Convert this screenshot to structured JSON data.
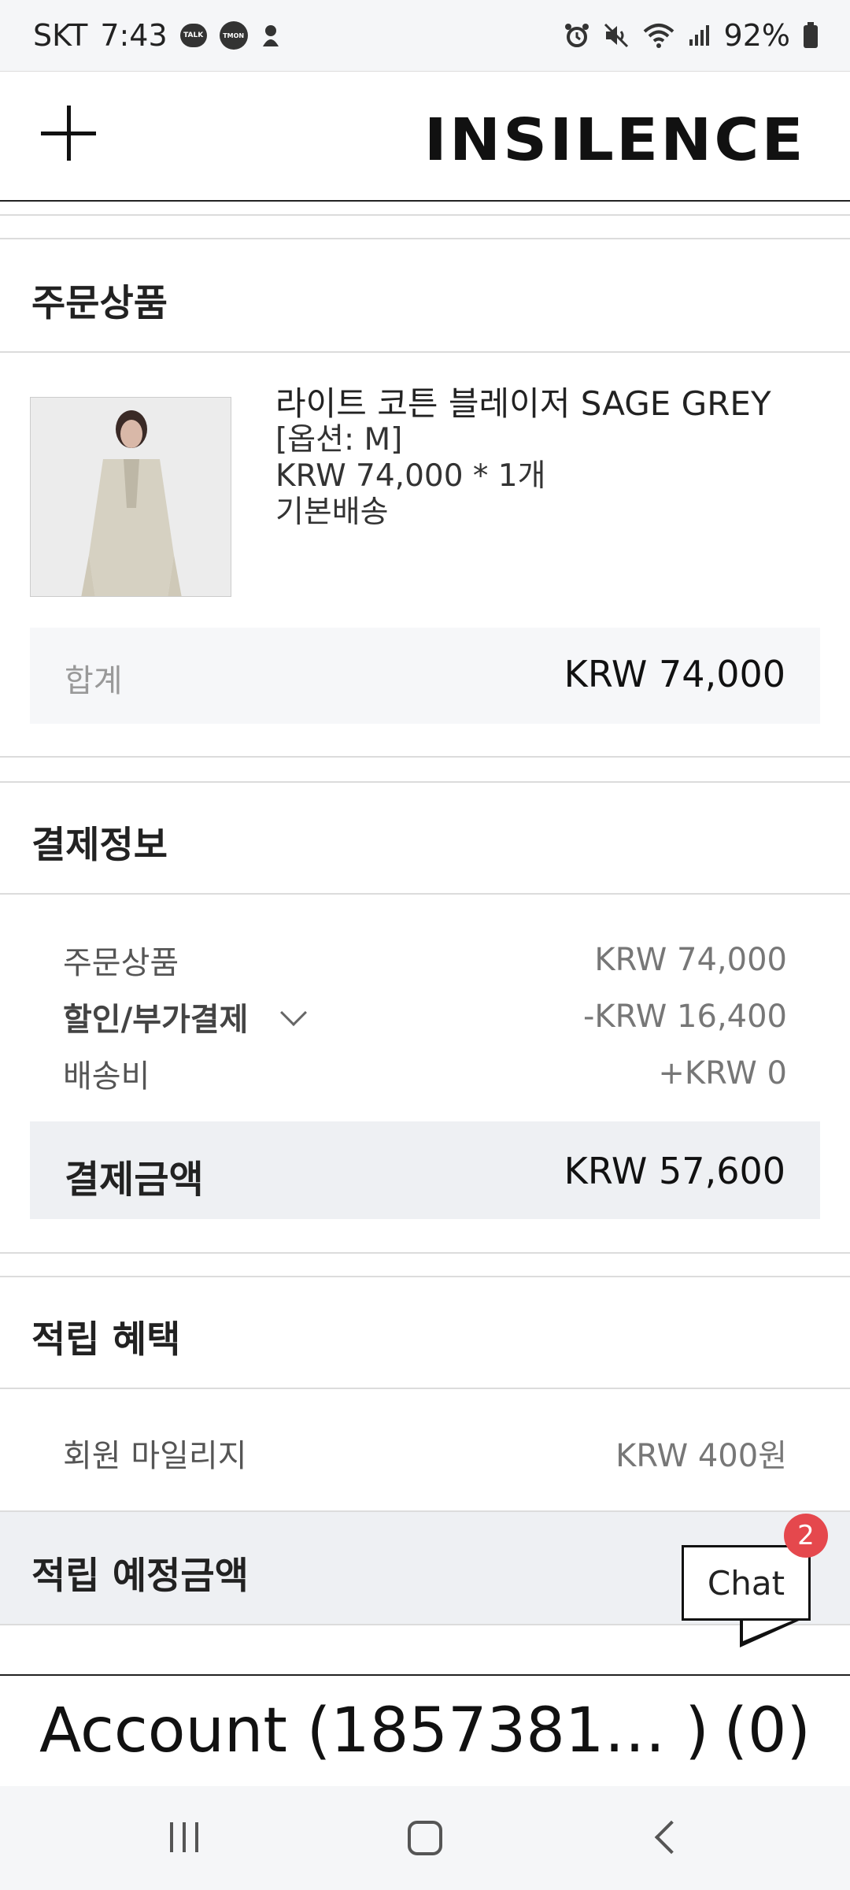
{
  "status_bar": {
    "carrier": "SKT",
    "time": "7:43",
    "app_icons": [
      "kakaotalk-icon",
      "tmon-icon",
      "notification-icon"
    ],
    "talk_text": "TALK",
    "tmon_text": "TMON",
    "system_icons": [
      "alarm-icon",
      "mute-icon",
      "wifi-icon",
      "signal-icon",
      "battery-icon"
    ],
    "battery": "92%"
  },
  "header": {
    "logo": "INSILENCE",
    "menu_icon": "plus-icon"
  },
  "order_section": {
    "title": "주문상품",
    "product": {
      "name": "라이트 코튼 블레이저 SAGE GREY",
      "option": "[옵션: M]",
      "price_qty": "KRW 74,000 *  1개",
      "shipping": "기본배송"
    },
    "total_label": "합계",
    "total_value": "KRW 74,000"
  },
  "payment_section": {
    "title": "결제정보",
    "rows": [
      {
        "label": "주문상품",
        "value": "KRW 74,000"
      },
      {
        "label": "할인/부가결제",
        "value": "-KRW 16,400"
      },
      {
        "label": "배송비",
        "value": "+KRW 0"
      }
    ],
    "pay_label": "결제금액",
    "pay_value": "KRW 57,600"
  },
  "reward_section": {
    "title": "적립 혜택",
    "mileage_label": "회원 마일리지",
    "mileage_value": "KRW 400원",
    "expected_title": "적립 예정금액"
  },
  "chat": {
    "label": "Chat",
    "badge_count": "2"
  },
  "account_bar": {
    "label": "Account (1857381… )",
    "count": "(0)"
  },
  "colors": {
    "accent_badge": "#e5484d",
    "panel_gray": "#eef0f3",
    "light_panel": "#f6f7f9"
  }
}
